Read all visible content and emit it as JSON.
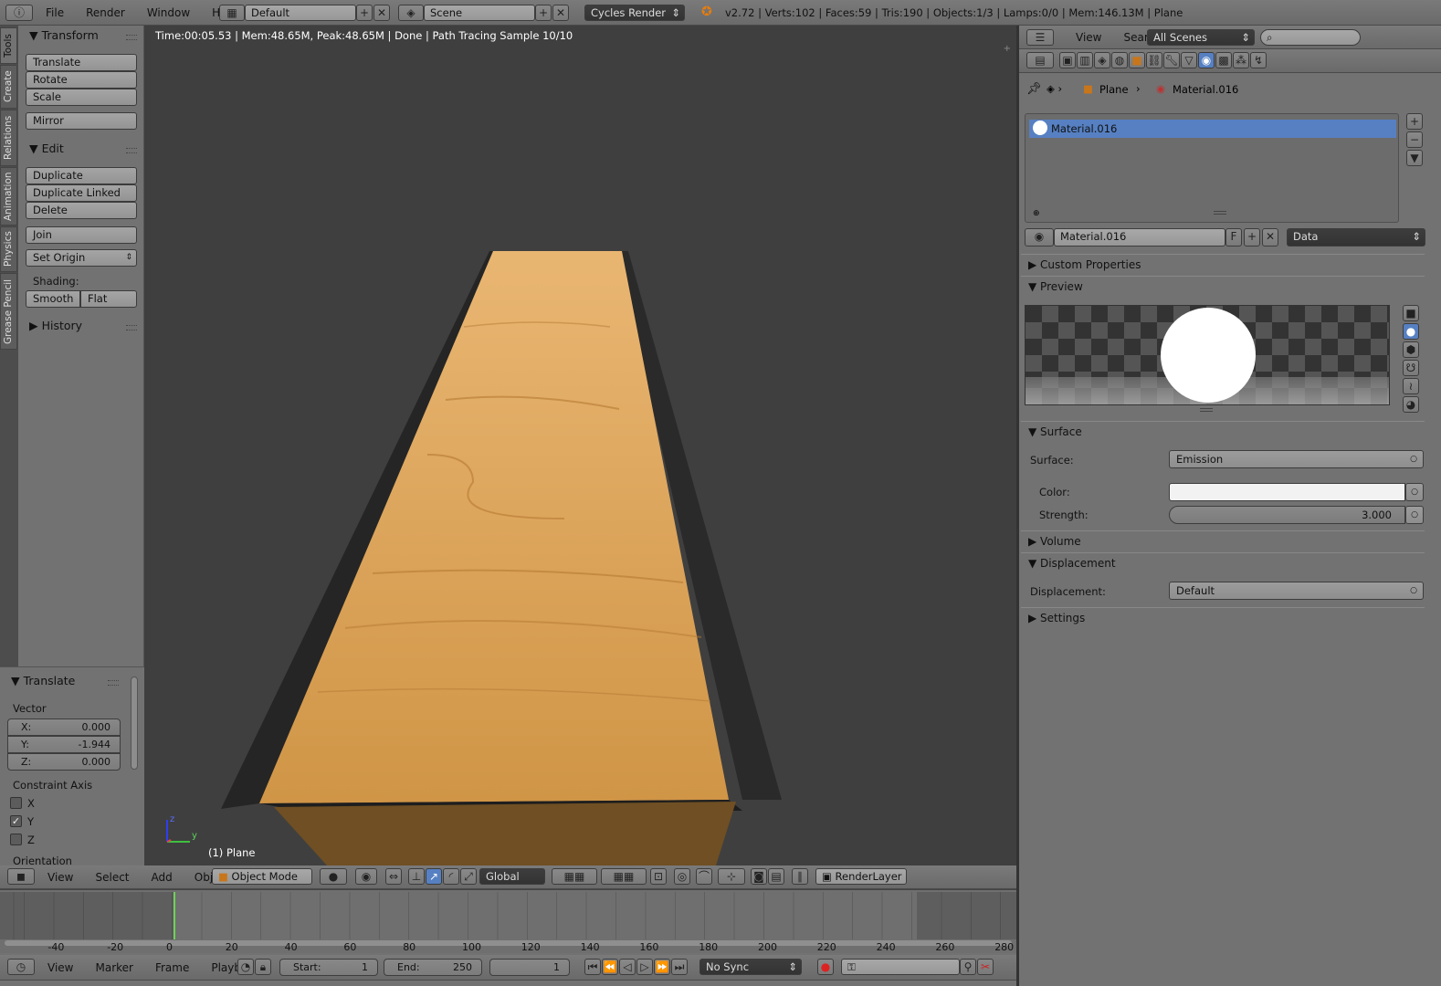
{
  "topbar": {
    "menus": [
      "File",
      "Render",
      "Window",
      "Help"
    ],
    "layout_name": "Default",
    "scene_name": "Scene",
    "render_engine": "Cycles Render",
    "stats": "v2.72 | Verts:102 | Faces:59 | Tris:190 | Objects:1/3 | Lamps:0/0 | Mem:146.13M | Plane"
  },
  "tool_tabs": [
    "Tools",
    "Create",
    "Relations",
    "Animation",
    "Physics",
    "Grease Pencil"
  ],
  "toolshelf": {
    "transform_title": "Transform",
    "translate": "Translate",
    "rotate": "Rotate",
    "scale": "Scale",
    "mirror": "Mirror",
    "edit_title": "Edit",
    "duplicate": "Duplicate",
    "duplicate_linked": "Duplicate Linked",
    "delete": "Delete",
    "join": "Join",
    "set_origin": "Set Origin",
    "shading_label": "Shading:",
    "smooth": "Smooth",
    "flat": "Flat",
    "history_title": "History"
  },
  "operator_panel": {
    "title": "Translate",
    "vector_label": "Vector",
    "x_label": "X:",
    "x_value": "0.000",
    "y_label": "Y:",
    "y_value": "-1.944",
    "z_label": "Z:",
    "z_value": "0.000",
    "constraint_label": "Constraint Axis",
    "axis_x": "X",
    "axis_y": "Y",
    "axis_z": "Z",
    "orientation_label": "Orientation"
  },
  "viewport": {
    "render_status": "Time:00:05.53 | Mem:48.65M, Peak:48.65M | Done | Path Tracing Sample 10/10",
    "object_label": "(1) Plane",
    "axis_z": "z",
    "axis_y": "y"
  },
  "view3d_header": {
    "menus": [
      "View",
      "Select",
      "Add",
      "Object"
    ],
    "mode": "Object Mode",
    "orientation": "Global",
    "render_layer": "RenderLayer"
  },
  "timeline": {
    "ticks": [
      "-40",
      "-20",
      "0",
      "20",
      "40",
      "60",
      "80",
      "100",
      "120",
      "140",
      "160",
      "180",
      "200",
      "220",
      "240",
      "260",
      "280"
    ],
    "menus": [
      "View",
      "Marker",
      "Frame",
      "Playback"
    ],
    "start_label": "Start:",
    "start_value": "1",
    "end_label": "End:",
    "end_value": "250",
    "current_frame": "1",
    "sync": "No Sync"
  },
  "properties": {
    "header_menus": [
      "View",
      "Search"
    ],
    "scenes_dropdown": "All Scenes",
    "breadcrumb_object": "Plane",
    "breadcrumb_material": "Material.016",
    "slot_name": "Material.016",
    "material_name": "Material.016",
    "fake_user": "F",
    "link_mode": "Data",
    "custom_properties": "Custom Properties",
    "preview": "Preview",
    "surface_section": "Surface",
    "surface_label": "Surface:",
    "surface_value": "Emission",
    "color_label": "Color:",
    "strength_label": "Strength:",
    "strength_value": "3.000",
    "volume": "Volume",
    "displacement_section": "Displacement",
    "displacement_label": "Displacement:",
    "displacement_value": "Default",
    "settings": "Settings"
  }
}
